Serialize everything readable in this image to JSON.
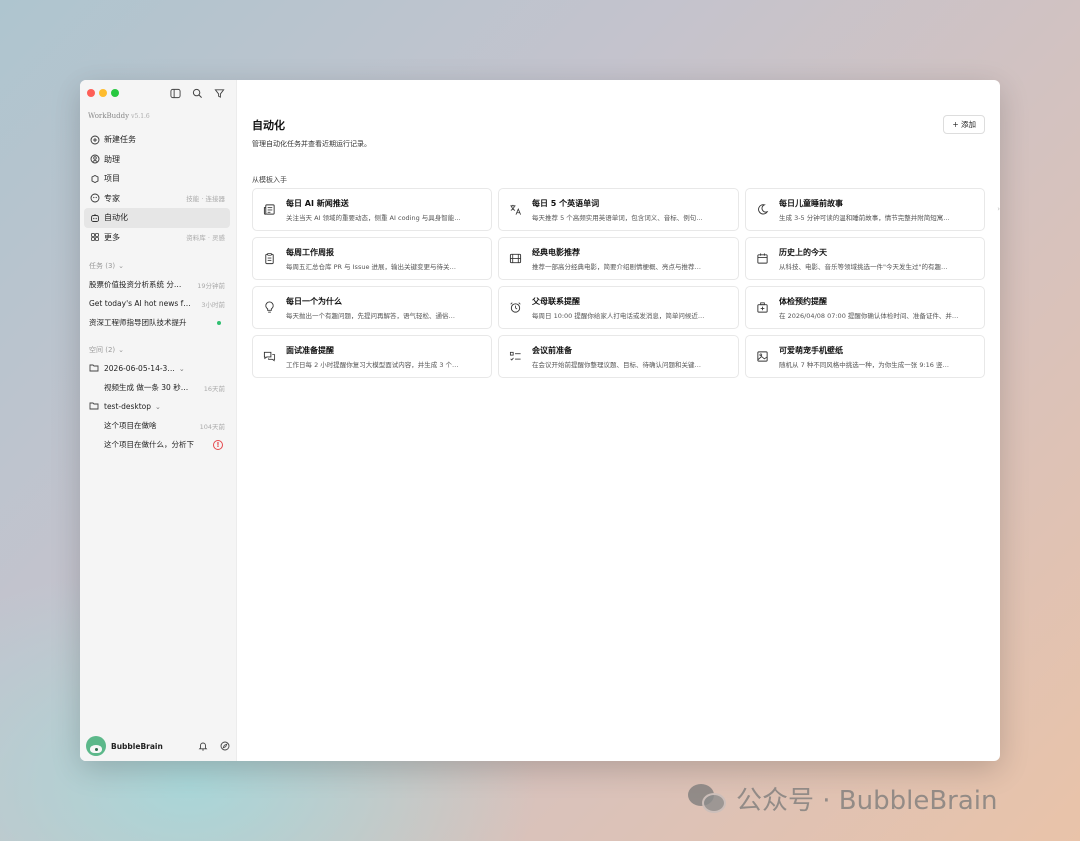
{
  "sidebar": {
    "brand": "WorkBuddy",
    "version": "v5.1.6",
    "nav": [
      {
        "label": "新建任务",
        "icon": "plus-circle-icon",
        "hint": ""
      },
      {
        "label": "助理",
        "icon": "assistant-icon",
        "hint": ""
      },
      {
        "label": "项目",
        "icon": "project-icon",
        "hint": ""
      },
      {
        "label": "专家",
        "icon": "expert-icon",
        "hint": "技能 · 连接器"
      },
      {
        "label": "自动化",
        "icon": "automation-icon",
        "hint": ""
      },
      {
        "label": "更多",
        "icon": "more-grid-icon",
        "hint": "资料库 · 灵感"
      }
    ],
    "tasks_header": "任务 (3)",
    "tasks": [
      {
        "title": "股票价值投资分析系统 分…",
        "time": "19分钟前"
      },
      {
        "title": "Get today's AI hot news f…",
        "time": "3小时前"
      },
      {
        "title": "资深工程师指导团队技术提升",
        "time": ""
      }
    ],
    "spaces_header": "空间 (2)",
    "spaces": [
      {
        "folder": "2026-06-05-14-3…",
        "items": [
          {
            "title": "视频生成 做一条 30 秒…",
            "time": "16天前",
            "warn": false
          }
        ]
      },
      {
        "folder": "test-desktop",
        "items": [
          {
            "title": "这个项目在做啥",
            "time": "104天前",
            "warn": false
          },
          {
            "title": "这个项目在做什么，分析下",
            "time": "",
            "warn": true
          }
        ]
      }
    ],
    "user": {
      "name": "BubbleBrain"
    }
  },
  "main": {
    "title": "自动化",
    "subtitle": "管理自动化任务并查看近期运行记录。",
    "add_label": "+ 添加",
    "templates_header": "从模板入手",
    "templates": [
      {
        "title": "每日 AI 新闻推送",
        "desc": "关注当天 AI 领域的重要动态，侧重 AI coding 与具身智能…",
        "icon": "newspaper-icon"
      },
      {
        "title": "每日 5 个英语单词",
        "desc": "每天推荐 5 个高频实用英语单词，包含词义、音标、例句…",
        "icon": "translate-icon"
      },
      {
        "title": "每日儿童睡前故事",
        "desc": "生成 3-5 分钟可读的温和睡前故事，情节完整并附简短寓…",
        "icon": "moon-icon"
      },
      {
        "title": "每周工作周报",
        "desc": "每周五汇总仓库 PR 与 Issue 进展，输出关键变更与待关…",
        "icon": "clipboard-icon"
      },
      {
        "title": "经典电影推荐",
        "desc": "推荐一部高分经典电影，简要介绍剧情梗概、亮点与推荐…",
        "icon": "film-icon"
      },
      {
        "title": "历史上的今天",
        "desc": "从科技、电影、音乐等领域挑选一件\"今天发生过\"的有趣…",
        "icon": "calendar-icon"
      },
      {
        "title": "每日一个为什么",
        "desc": "每天抛出一个有趣问题，先提问再解答，语气轻松、通俗…",
        "icon": "lightbulb-icon"
      },
      {
        "title": "父母联系提醒",
        "desc": "每周日 10:00 提醒你给家人打电话或发消息，简单问候近…",
        "icon": "alarm-clock-icon"
      },
      {
        "title": "体检预约提醒",
        "desc": "在 2026/04/08 07:00 提醒你确认体检时间、准备证件、并…",
        "icon": "hospital-icon"
      },
      {
        "title": "面试准备提醒",
        "desc": "工作日每 2 小时提醒你复习大模型面试内容，并生成 3 个…",
        "icon": "chat-bubbles-icon"
      },
      {
        "title": "会议前准备",
        "desc": "在会议开始前提醒你整理议题、目标、待确认问题和关键…",
        "icon": "checklist-icon"
      },
      {
        "title": "可爱萌宠手机壁纸",
        "desc": "随机从 7 种不同风格中挑选一种，为你生成一张 9:16 竖…",
        "icon": "image-icon"
      }
    ]
  },
  "watermark": {
    "text": "公众号 · BubbleBrain"
  }
}
